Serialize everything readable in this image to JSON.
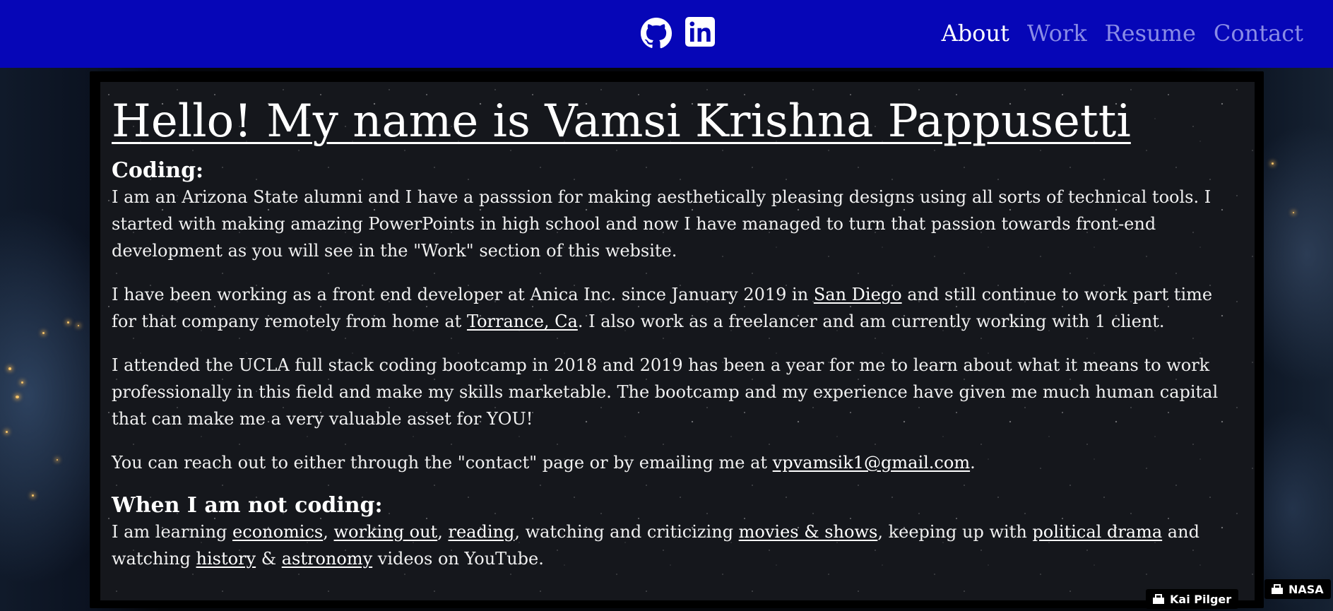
{
  "navbar": {
    "social": [
      {
        "icon": "github-icon"
      },
      {
        "icon": "linkedin-icon"
      }
    ],
    "links": [
      {
        "label": "About",
        "active": true
      },
      {
        "label": "Work",
        "active": false
      },
      {
        "label": "Resume",
        "active": false
      },
      {
        "label": "Contact",
        "active": false
      }
    ]
  },
  "about": {
    "title": "Hello! My name is Vamsi Krishna Pappusetti",
    "coding_heading": "Coding:",
    "p1": "I am an Arizona State alumni and I have a passsion for making aesthetically pleasing designs using all sorts of technical tools. I started with making amazing PowerPoints in high school and now I have managed to turn that passion towards front-end development as you will see in the \"Work\" section of this website.",
    "p2": {
      "t1": "I have been working as a front end developer at Anica Inc. since January 2019 in ",
      "link1": "San Diego",
      "t2": " and still continue to work part time for that company remotely from home at ",
      "link2": "Torrance, Ca",
      "t3": ". I also work as a freelancer and am currently working with 1 client."
    },
    "p3": "I attended the UCLA full stack coding bootcamp in 2018 and 2019 has been a year for me to learn about what it means to work professionally in this field and make my skills marketable. The bootcamp and my experience have given me much human capital that can make me a very valuable asset for YOU!",
    "p4": {
      "t1": "You can reach out to either through the \"contact\" page or by emailing me at ",
      "email": "vpvamsik1@gmail.com",
      "t2": "."
    },
    "not_coding_heading": "When I am not coding:",
    "p5": {
      "t1": "I am learning ",
      "l1": "economics",
      "s1": ", ",
      "l2": "working out",
      "s2": ", ",
      "l3": "reading",
      "s3": ", watching and criticizing ",
      "l4": "movies & shows",
      "s4": ", keeping up with ",
      "l5": "political drama",
      "s5": " and watching ",
      "l6": "history",
      "s6": " & ",
      "l7": "astronomy",
      "s7": " videos on YouTube."
    }
  },
  "credits": {
    "inner": "Kai Pilger",
    "outer": "NASA",
    "icon": "camera-icon"
  },
  "colors": {
    "navbar_bg": "#0606b7",
    "nav_active": "#ffffff",
    "nav_inactive": "#8a8ce6"
  }
}
